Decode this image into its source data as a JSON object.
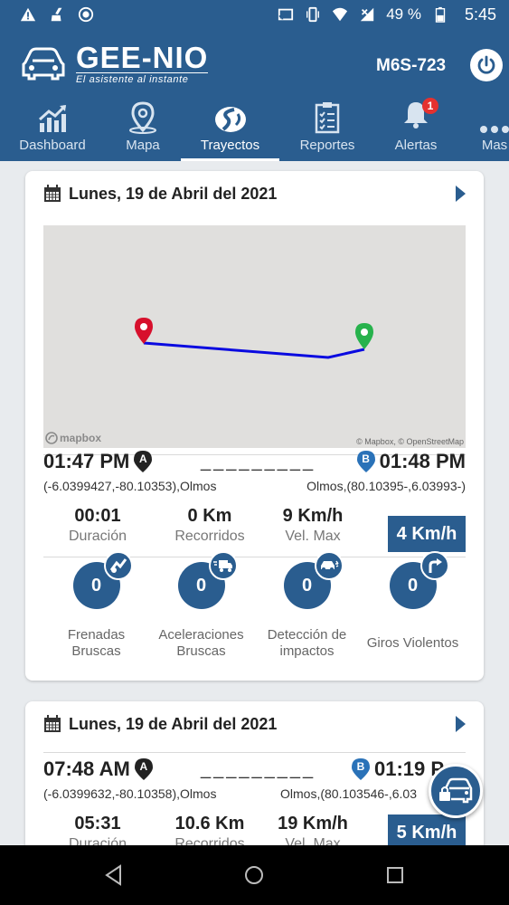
{
  "status_bar": {
    "battery": "49 %",
    "time": "5:45"
  },
  "header": {
    "app_name": "GEE-NIO",
    "app_tagline": "El asistente al instante",
    "plate": "M6S-723",
    "accent_color": "#2a5d8f"
  },
  "tabs": [
    {
      "label": "Dashboard",
      "icon": "chart-icon"
    },
    {
      "label": "Mapa",
      "icon": "map-pin-icon"
    },
    {
      "label": "Trayectos",
      "icon": "route-icon",
      "active": true
    },
    {
      "label": "Reportes",
      "icon": "report-icon"
    },
    {
      "label": "Alertas",
      "icon": "bell-icon",
      "badge": "1"
    },
    {
      "label": "Mas",
      "icon": "more-icon"
    }
  ],
  "trips": [
    {
      "date": "Lunes, 19 de Abril del 2021",
      "map": {
        "logo": "mapbox",
        "attribution": "© Mapbox, © OpenStreetMap"
      },
      "start_time": "01:47 PM",
      "start_marker": "A",
      "end_time": "01:48 PM",
      "end_marker": "B",
      "separator": "_________",
      "start_coords": "(-6.0399427,-80.10353),Olmos",
      "end_coords": "Olmos,(80.10395-,6.03993-)",
      "duration_value": "00:01",
      "duration_label": "Duración",
      "distance_value": "0 Km",
      "distance_label": "Recorridos",
      "max_speed_value": "9 Km/h",
      "max_speed_label": "Vel. Max",
      "avg_speed": "4 Km/h",
      "events": [
        {
          "count": "0",
          "label_line1": "Frenadas",
          "label_line2": "Bruscas",
          "icon": "brake-icon"
        },
        {
          "count": "0",
          "label_line1": "Aceleraciones",
          "label_line2": "Bruscas",
          "icon": "truck-icon"
        },
        {
          "count": "0",
          "label_line1": "Detección de",
          "label_line2": "impactos",
          "icon": "car-crash-icon"
        },
        {
          "count": "0",
          "label_line1": "Giros Violentos",
          "label_line2": "",
          "icon": "turn-right-icon"
        }
      ]
    },
    {
      "date": "Lunes, 19 de Abril del 2021",
      "start_time": "07:48 AM",
      "start_marker": "A",
      "end_time": "01:19 P",
      "end_marker": "B",
      "separator": "_________",
      "start_coords": "(-6.0399632,-80.10358),Olmos",
      "end_coords": "Olmos,(80.103546-,6.03",
      "duration_value": "05:31",
      "duration_label": "Duración",
      "distance_value": "10.6 Km",
      "distance_label": "Recorridos",
      "max_speed_value": "19 Km/h",
      "max_speed_label": "Vel. Max",
      "avg_speed": "5 Km/h"
    }
  ]
}
